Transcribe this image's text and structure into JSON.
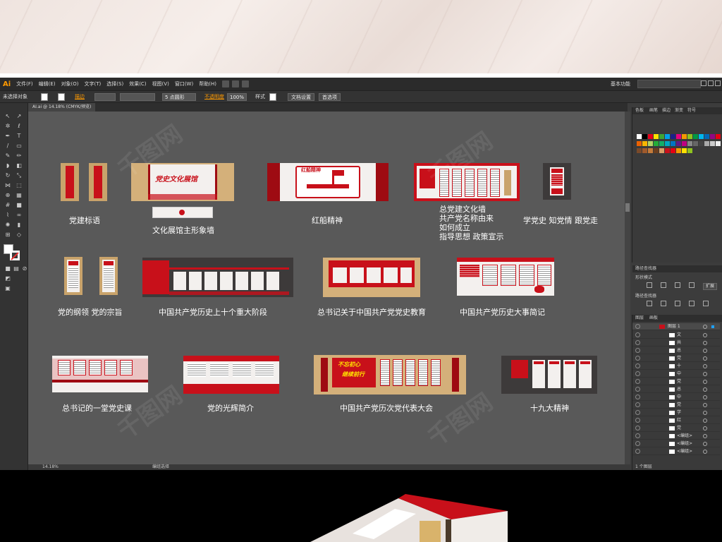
{
  "app": {
    "logo": "Ai",
    "menus": [
      "文件(F)",
      "编辑(E)",
      "对象(O)",
      "文字(T)",
      "选择(S)",
      "效果(C)",
      "视图(V)",
      "窗口(W)",
      "帮助(H)"
    ],
    "workspace": "基本功能"
  },
  "control_bar": {
    "selection": "未选择对象",
    "stroke_label": "描边",
    "brush_label": "5 点圆形",
    "opacity_label": "不透明度",
    "opacity_value": "100%",
    "style_label": "样式",
    "doc_setup_button": "文档设置",
    "prefs_button": "首选项"
  },
  "document": {
    "tab_title": "AI.ai @ 14.18% (CMYK/预览)",
    "zoom": "14.18%",
    "status_text": "编组选择"
  },
  "artboards": [
    {
      "caption": "党建标语"
    },
    {
      "caption": "文化展馆主形象墙"
    },
    {
      "caption": "红船精神"
    },
    {
      "caption": "总党建文化墙\n共产党名称由来\n如何成立\n指导思想 政策宣示"
    },
    {
      "caption": "学党史 知党情 跟党走"
    },
    {
      "caption": "党的纲领  党的宗旨"
    },
    {
      "caption": "中国共产党历史上十个重大阶段"
    },
    {
      "caption": "总书记关于中国共产党党史教育"
    },
    {
      "caption": "中国共产党历史大事简记"
    },
    {
      "caption": "总书记的一堂党史课"
    },
    {
      "caption": "党的光辉简介"
    },
    {
      "caption": "中国共产党历次党代表大会"
    },
    {
      "caption": "十九大精神"
    }
  ],
  "art_text": {
    "culture_wall_title": "党史文化展馆",
    "red_boat_title": "红船精神",
    "congress_slogan_1": "不忘初心",
    "congress_slogan_2": "继续前行"
  },
  "panels": {
    "color_tabs": [
      "色板",
      "画笔",
      "描边",
      "渐变",
      "符号"
    ],
    "pathfinder_title": "路径查找器",
    "shape_modes": "形状模式",
    "pathfinder": "路径查找器",
    "apply_button": "扩展",
    "layers_tabs": [
      "图层",
      "画板"
    ],
    "layer_top": "图层 1",
    "layers": [
      "文",
      "共",
      "总",
      "党",
      "十",
      "中",
      "党",
      "总",
      "中",
      "党",
      "学",
      "红",
      "党",
      "<编组>",
      "<编组>",
      "<编组>"
    ],
    "layers_count": "1 个图层"
  },
  "colors": {
    "party_red": "#c8101a",
    "gold": "#c9a36b",
    "canvas": "#595959",
    "accent_orange": "#ff9a00"
  },
  "swatches": [
    "#ffffff",
    "#000000",
    "#e6001a",
    "#ffe100",
    "#3fa535",
    "#00a0e9",
    "#1d2088",
    "#e4007f",
    "#f39800",
    "#8fc31f",
    "#009944",
    "#00b7ee",
    "#0068b7",
    "#920783",
    "#e60012",
    "#eb6100",
    "#f8b500",
    "#b3d465",
    "#22ac38",
    "#13ae67",
    "#00a7c1",
    "#0075c2",
    "#601986",
    "#be0081",
    "#888888",
    "#666666",
    "#444444",
    "#aaaaaa",
    "#cccccc",
    "#eeeeee",
    "#7a4a2a",
    "#a05a2c",
    "#c47b3a",
    "#6b3e1e",
    "#d9a066",
    "#c8101a",
    "#e60012",
    "#f39800",
    "#ffe100",
    "#8fc31f"
  ]
}
